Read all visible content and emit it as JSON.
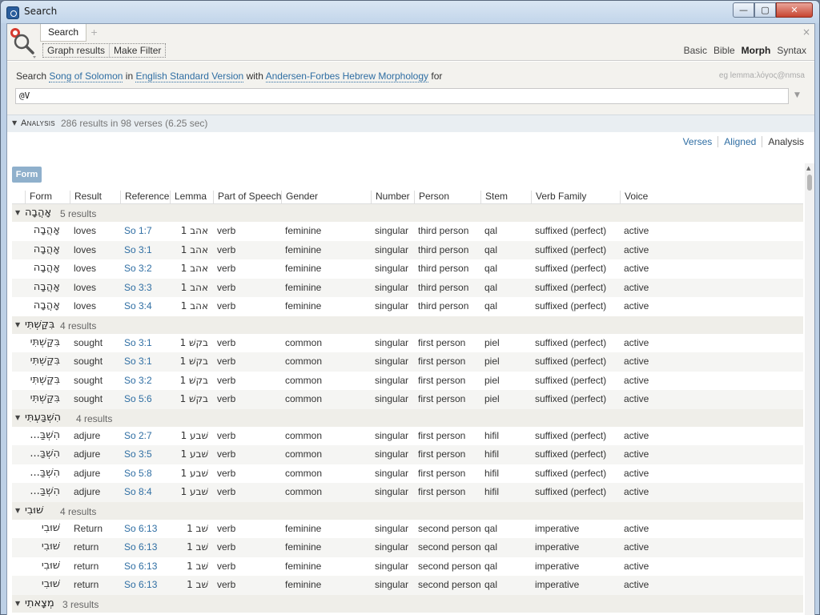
{
  "window": {
    "title": "Search",
    "min_glyph": "—",
    "max_glyph": "▢",
    "close_glyph": "✕"
  },
  "tab": {
    "label": "Search",
    "add_glyph": "+",
    "close_glyph": "×"
  },
  "toolbar": {
    "graph_results": "Graph results",
    "make_filter": "Make Filter"
  },
  "modes": [
    "Basic",
    "Bible",
    "Morph",
    "Syntax"
  ],
  "active_mode": "Morph",
  "search": {
    "prefix": "Search",
    "scope": "Song of Solomon",
    "in_word": "in",
    "version": "English Standard Version",
    "with_word": "with",
    "morphology": "Andersen-Forbes Hebrew Morphology",
    "for_word": "for",
    "hint": "eg lemma:λόγος@nmsa",
    "query": "@V"
  },
  "analysis": {
    "label": "Analysis",
    "stats": "286 results in 98 verses (6.25 sec)"
  },
  "view_tabs": [
    "Verses",
    "Aligned",
    "Analysis"
  ],
  "active_view": "Analysis",
  "form_chip": "Form",
  "columns": [
    "Form",
    "Result",
    "Reference",
    "Lemma",
    "Part of Speech",
    "Gender",
    "Number",
    "Person",
    "Stem",
    "Verb Family",
    "Voice"
  ],
  "groups": [
    {
      "form": "אָהֲבָה",
      "count": "5 results",
      "rows": [
        [
          "אָהֲבָה",
          "loves",
          "So 1:7",
          "אהב 1",
          "verb",
          "feminine",
          "singular",
          "third person",
          "qal",
          "suffixed (perfect)",
          "active"
        ],
        [
          "אָהֲבָה",
          "loves",
          "So 3:1",
          "אהב 1",
          "verb",
          "feminine",
          "singular",
          "third person",
          "qal",
          "suffixed (perfect)",
          "active"
        ],
        [
          "אָהֲבָה",
          "loves",
          "So 3:2",
          "אהב 1",
          "verb",
          "feminine",
          "singular",
          "third person",
          "qal",
          "suffixed (perfect)",
          "active"
        ],
        [
          "אָהֲבָה",
          "loves",
          "So 3:3",
          "אהב 1",
          "verb",
          "feminine",
          "singular",
          "third person",
          "qal",
          "suffixed (perfect)",
          "active"
        ],
        [
          "אָהֲבָה",
          "loves",
          "So 3:4",
          "אהב 1",
          "verb",
          "feminine",
          "singular",
          "third person",
          "qal",
          "suffixed (perfect)",
          "active"
        ]
      ]
    },
    {
      "form": "בִּקַּשְׁתִּי",
      "count": "4 results",
      "rows": [
        [
          "בִּקַּשְׁתִּי",
          "sought",
          "So 3:1",
          "בקשׁ 1",
          "verb",
          "common",
          "singular",
          "first person",
          "piel",
          "suffixed (perfect)",
          "active"
        ],
        [
          "בִּקַּשְׁתִּי",
          "sought",
          "So 3:1",
          "בקשׁ 1",
          "verb",
          "common",
          "singular",
          "first person",
          "piel",
          "suffixed (perfect)",
          "active"
        ],
        [
          "בִּקַּשְׁתִּי",
          "sought",
          "So 3:2",
          "בקשׁ 1",
          "verb",
          "common",
          "singular",
          "first person",
          "piel",
          "suffixed (perfect)",
          "active"
        ],
        [
          "בִּקַּשְׁתִּי",
          "sought",
          "So 5:6",
          "בקשׁ 1",
          "verb",
          "common",
          "singular",
          "first person",
          "piel",
          "suffixed (perfect)",
          "active"
        ]
      ]
    },
    {
      "form": "הִשְׁבַּעְתִּי",
      "count": "4 results",
      "rows": [
        [
          "הִשְׁבַּ...",
          "adjure",
          "So 2:7",
          "שׁבע 1",
          "verb",
          "common",
          "singular",
          "first person",
          "hifil",
          "suffixed (perfect)",
          "active"
        ],
        [
          "הִשְׁבַּ...",
          "adjure",
          "So 3:5",
          "שׁבע 1",
          "verb",
          "common",
          "singular",
          "first person",
          "hifil",
          "suffixed (perfect)",
          "active"
        ],
        [
          "הִשְׁבַּ...",
          "adjure",
          "So 5:8",
          "שׁבע 1",
          "verb",
          "common",
          "singular",
          "first person",
          "hifil",
          "suffixed (perfect)",
          "active"
        ],
        [
          "הִשְׁבַּ...",
          "adjure",
          "So 8:4",
          "שׁבע 1",
          "verb",
          "common",
          "singular",
          "first person",
          "hifil",
          "suffixed (perfect)",
          "active"
        ]
      ]
    },
    {
      "form": "שׁוּבִי",
      "count": "4 results",
      "rows": [
        [
          "שׁוּבִי",
          "Return",
          "So 6:13",
          "שׁב 1",
          "verb",
          "feminine",
          "singular",
          "second person",
          "qal",
          "imperative",
          "active"
        ],
        [
          "שׁוּבִי",
          "return",
          "So 6:13",
          "שׁב 1",
          "verb",
          "feminine",
          "singular",
          "second person",
          "qal",
          "imperative",
          "active"
        ],
        [
          "שׁוּבִי",
          "return",
          "So 6:13",
          "שׁב 1",
          "verb",
          "feminine",
          "singular",
          "second person",
          "qal",
          "imperative",
          "active"
        ],
        [
          "שׁוּבִי",
          "return",
          "So 6:13",
          "שׁב 1",
          "verb",
          "feminine",
          "singular",
          "second person",
          "qal",
          "imperative",
          "active"
        ]
      ]
    },
    {
      "form": "מְצָאתִי",
      "count": "3 results",
      "rows": []
    }
  ],
  "colors": {
    "link": "#2f6ea3",
    "group_bg": "#efeee9",
    "chip": "#8fb0cc",
    "close": "#c74530"
  }
}
